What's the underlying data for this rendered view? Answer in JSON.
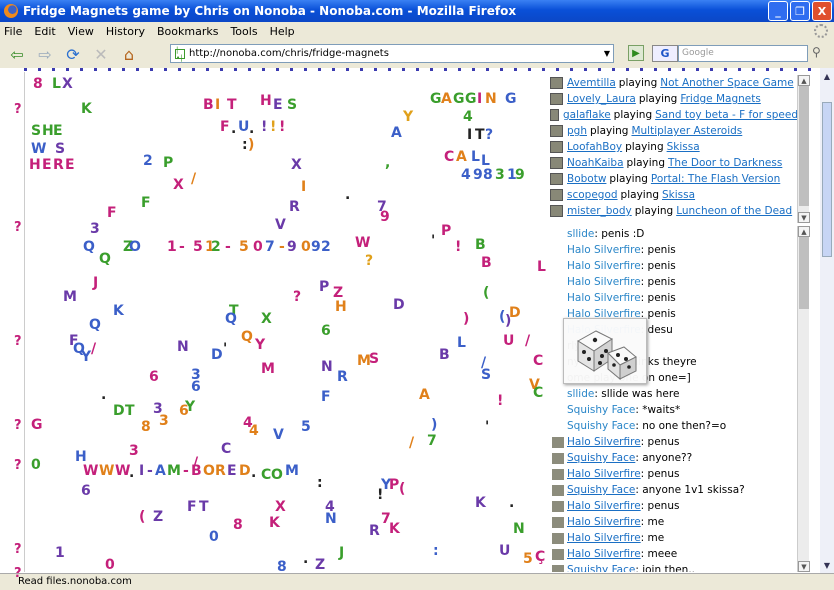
{
  "window": {
    "title": "Fridge Magnets game by Chris on Nonoba - Nonoba.com - Mozilla Firefox",
    "min_label": "_",
    "max_label": "❐",
    "close_label": "X"
  },
  "menu": [
    "File",
    "Edit",
    "View",
    "History",
    "Bookmarks",
    "Tools",
    "Help"
  ],
  "nav": {
    "back": "⇦",
    "forward": "⇨",
    "reload": "⟳",
    "stop": "✕",
    "home": "⌂",
    "url": "http://nonoba.com/chris/fridge-magnets",
    "go": "▶",
    "search_engine": "G",
    "search_placeholder": "Google",
    "search_icon": "⚲"
  },
  "colors": {
    "accent": "#0a50d8",
    "link": "#1a6fc4",
    "chat_name": "#2a86c8"
  },
  "magnets": [
    [
      "8",
      8,
      5,
      "#c4207a"
    ],
    [
      "L",
      27,
      5,
      "#3a9e2c"
    ],
    [
      "X",
      37,
      5,
      "#6a3aa8"
    ],
    [
      "K",
      56,
      30,
      "#3a9e2c"
    ],
    [
      "B",
      178,
      26,
      "#c4207a"
    ],
    [
      "I",
      190,
      26,
      "#e0801a"
    ],
    [
      "T",
      202,
      26,
      "#c4207a"
    ],
    [
      "H",
      235,
      22,
      "#c4207a"
    ],
    [
      "E",
      248,
      26,
      "#6a3aa8"
    ],
    [
      "S",
      262,
      26,
      "#3a9e2c"
    ],
    [
      "F",
      195,
      48,
      "#c4207a"
    ],
    [
      ".",
      206,
      50,
      "#222"
    ],
    [
      "U",
      213,
      48,
      "#3b5fc8"
    ],
    [
      ".",
      224,
      50,
      "#222"
    ],
    [
      "!",
      236,
      48,
      "#6a3aa8"
    ],
    [
      "!",
      245,
      48,
      "#e0a01a"
    ],
    [
      "!",
      254,
      48,
      "#c4207a"
    ],
    [
      ":",
      217,
      66,
      "#222"
    ],
    [
      ")",
      223,
      66,
      "#e0801a"
    ],
    [
      "G",
      405,
      20,
      "#3a9e2c"
    ],
    [
      "A",
      416,
      20,
      "#e0801a"
    ],
    [
      "G",
      428,
      20,
      "#3a9e2c"
    ],
    [
      "G",
      440,
      20,
      "#3a9e2c"
    ],
    [
      "I",
      452,
      20,
      "#c4207a"
    ],
    [
      "N",
      460,
      20,
      "#e0801a"
    ],
    [
      "G",
      480,
      20,
      "#3b5fc8"
    ],
    [
      "Y",
      378,
      38,
      "#e0a01a"
    ],
    [
      "4",
      438,
      38,
      "#3a9e2c"
    ],
    [
      "A",
      366,
      54,
      "#3b5fc8"
    ],
    [
      "I",
      442,
      56,
      "#222"
    ],
    [
      "T",
      450,
      56,
      "#222"
    ],
    [
      "?",
      460,
      56,
      "#3b5fc8"
    ],
    [
      "C",
      419,
      78,
      "#c4207a"
    ],
    [
      "A",
      431,
      78,
      "#e0801a"
    ],
    [
      "L",
      446,
      78,
      "#3b5fc8"
    ],
    [
      "L",
      456,
      82,
      "#3b5fc8"
    ],
    [
      "4",
      436,
      96,
      "#3b5fc8"
    ],
    [
      "9",
      448,
      96,
      "#3b5fc8"
    ],
    [
      "8",
      458,
      96,
      "#3b5fc8"
    ],
    [
      "3",
      470,
      96,
      "#3a9e2c"
    ],
    [
      "1",
      482,
      96,
      "#3b5fc8"
    ],
    [
      "9",
      490,
      96,
      "#3a9e2c"
    ],
    [
      "S",
      6,
      52,
      "#3a9e2c"
    ],
    [
      "H",
      17,
      52,
      "#3a9e2c"
    ],
    [
      "E",
      28,
      52,
      "#3a9e2c"
    ],
    [
      "W",
      6,
      70,
      "#3b5fc8"
    ],
    [
      "S",
      30,
      70,
      "#6a3aa8"
    ],
    [
      "H",
      4,
      86,
      "#c4207a"
    ],
    [
      "E",
      17,
      86,
      "#c4207a"
    ],
    [
      "R",
      28,
      86,
      "#c4207a"
    ],
    [
      "E",
      40,
      86,
      "#c4207a"
    ],
    [
      "2",
      118,
      82,
      "#3b5fc8"
    ],
    [
      "P",
      138,
      84,
      "#3a9e2c"
    ],
    [
      "X",
      148,
      106,
      "#c4207a"
    ],
    [
      "/",
      166,
      100,
      "#e0801a"
    ],
    [
      "X",
      266,
      86,
      "#6a3aa8"
    ],
    [
      "I",
      276,
      108,
      "#e0801a"
    ],
    [
      ",",
      360,
      84,
      "#3a9e2c"
    ],
    [
      "F",
      82,
      134,
      "#c4207a"
    ],
    [
      "F",
      116,
      124,
      "#3a9e2c"
    ],
    [
      "3",
      65,
      150,
      "#6a3aa8"
    ],
    [
      "R",
      264,
      128,
      "#6a3aa8"
    ],
    [
      "V",
      250,
      146,
      "#6a3aa8"
    ],
    [
      ".",
      320,
      116,
      "#222"
    ],
    [
      "7",
      352,
      128,
      "#6a3aa8"
    ],
    [
      "9",
      355,
      138,
      "#c4207a"
    ],
    [
      "P",
      416,
      152,
      "#c4207a"
    ],
    [
      "'",
      406,
      162,
      "#222"
    ],
    [
      "!",
      430,
      168,
      "#c4207a"
    ],
    [
      "B",
      450,
      166,
      "#3a9e2c"
    ],
    [
      "Q",
      58,
      168,
      "#3b5fc8"
    ],
    [
      "Z",
      98,
      168,
      "#3a9e2c"
    ],
    [
      "Q",
      74,
      180,
      "#3a9e2c"
    ],
    [
      "O",
      104,
      168,
      "#3b5fc8"
    ],
    [
      "1",
      142,
      168,
      "#c4207a"
    ],
    [
      "-",
      154,
      168,
      "#c4207a"
    ],
    [
      "5",
      168,
      168,
      "#c4207a"
    ],
    [
      "1",
      180,
      168,
      "#e0801a"
    ],
    [
      "2",
      186,
      168,
      "#3a9e2c"
    ],
    [
      "-",
      200,
      168,
      "#c4207a"
    ],
    [
      "5",
      214,
      168,
      "#e0801a"
    ],
    [
      "0",
      228,
      168,
      "#c4207a"
    ],
    [
      "7",
      240,
      168,
      "#3b5fc8"
    ],
    [
      "-",
      254,
      168,
      "#e0801a"
    ],
    [
      "9",
      262,
      168,
      "#6a3aa8"
    ],
    [
      "0",
      276,
      168,
      "#e0801a"
    ],
    [
      "9",
      286,
      168,
      "#3b5fc8"
    ],
    [
      "2",
      296,
      168,
      "#3b5fc8"
    ],
    [
      "W",
      330,
      164,
      "#c4207a"
    ],
    [
      "?",
      340,
      182,
      "#e0a01a"
    ],
    [
      "B",
      456,
      184,
      "#c4207a"
    ],
    [
      "L",
      512,
      188,
      "#c4207a"
    ],
    [
      "J",
      68,
      204,
      "#c4207a"
    ],
    [
      "M",
      38,
      218,
      "#6a3aa8"
    ],
    [
      "?",
      268,
      218,
      "#c4207a"
    ],
    [
      "P",
      294,
      208,
      "#6a3aa8"
    ],
    [
      "Z",
      308,
      214,
      "#c4207a"
    ],
    [
      "H",
      310,
      228,
      "#e0801a"
    ],
    [
      "D",
      368,
      226,
      "#6a3aa8"
    ],
    [
      "(",
      458,
      214,
      "#3a9e2c"
    ],
    [
      "K",
      88,
      232,
      "#3b5fc8"
    ],
    [
      "Q",
      64,
      246,
      "#3b5fc8"
    ],
    [
      "T",
      204,
      232,
      "#3a9e2c"
    ],
    [
      "Q",
      200,
      240,
      "#3b5fc8"
    ],
    [
      "X",
      236,
      240,
      "#3a9e2c"
    ],
    [
      "6",
      296,
      252,
      "#3a9e2c"
    ],
    [
      ")",
      438,
      240,
      "#c4207a"
    ],
    [
      "(",
      474,
      238,
      "#3b5fc8"
    ],
    [
      "D",
      484,
      234,
      "#e0801a"
    ],
    [
      ")",
      480,
      242,
      "#6a3aa8"
    ],
    [
      "Q",
      216,
      258,
      "#e0801a"
    ],
    [
      "Y",
      230,
      266,
      "#c4207a"
    ],
    [
      "F",
      44,
      262,
      "#6a3aa8"
    ],
    [
      "Q",
      48,
      270,
      "#3b5fc8"
    ],
    [
      "Y",
      56,
      278,
      "#3b5fc8"
    ],
    [
      "/",
      66,
      270,
      "#c4207a"
    ],
    [
      "N",
      152,
      268,
      "#6a3aa8"
    ],
    [
      "D",
      186,
      276,
      "#3b5fc8"
    ],
    [
      "'",
      198,
      270,
      "#222"
    ],
    [
      "L",
      432,
      264,
      "#3b5fc8"
    ],
    [
      "B",
      414,
      276,
      "#6a3aa8"
    ],
    [
      "U",
      478,
      262,
      "#c4207a"
    ],
    [
      "/",
      500,
      262,
      "#c4207a"
    ],
    [
      "C",
      508,
      282,
      "#c4207a"
    ],
    [
      "/",
      456,
      284,
      "#3b5fc8"
    ],
    [
      "M",
      236,
      290,
      "#c4207a"
    ],
    [
      "N",
      296,
      288,
      "#6a3aa8"
    ],
    [
      "R",
      312,
      298,
      "#3b5fc8"
    ],
    [
      "M",
      332,
      282,
      "#e0801a"
    ],
    [
      "S",
      344,
      280,
      "#c4207a"
    ],
    [
      "S",
      456,
      296,
      "#3b5fc8"
    ],
    [
      "6",
      124,
      298,
      "#c4207a"
    ],
    [
      "3",
      166,
      296,
      "#3b5fc8"
    ],
    [
      "6",
      166,
      308,
      "#3b5fc8"
    ],
    [
      ".",
      76,
      316,
      "#222"
    ],
    [
      "F",
      296,
      318,
      "#3b5fc8"
    ],
    [
      "A",
      394,
      316,
      "#e0801a"
    ],
    [
      "V",
      504,
      306,
      "#e0801a"
    ],
    [
      "C",
      508,
      314,
      "#3a9e2c"
    ],
    [
      "!",
      472,
      322,
      "#c4207a"
    ],
    [
      "D",
      88,
      332,
      "#3a9e2c"
    ],
    [
      "T",
      100,
      332,
      "#3a9e2c"
    ],
    [
      "3",
      128,
      330,
      "#6a3aa8"
    ],
    [
      "6",
      154,
      332,
      "#e0801a"
    ],
    [
      "Y",
      160,
      328,
      "#3a9e2c"
    ],
    [
      "8",
      116,
      348,
      "#e0801a"
    ],
    [
      "3",
      134,
      342,
      "#e0801a"
    ],
    [
      "4",
      218,
      344,
      "#c4207a"
    ],
    [
      "4",
      224,
      352,
      "#e0801a"
    ],
    [
      "V",
      248,
      356,
      "#3b5fc8"
    ],
    [
      "5",
      276,
      348,
      "#3b5fc8"
    ],
    [
      ")",
      406,
      346,
      "#3b5fc8"
    ],
    [
      "'",
      460,
      348,
      "#222"
    ],
    [
      "G",
      6,
      346,
      "#c4207a"
    ],
    [
      "C",
      196,
      370,
      "#6a3aa8"
    ],
    [
      "/",
      384,
      364,
      "#e0801a"
    ],
    [
      "7",
      402,
      362,
      "#3a9e2c"
    ],
    [
      "H",
      50,
      378,
      "#3b5fc8"
    ],
    [
      "3",
      104,
      372,
      "#c4207a"
    ],
    [
      "/",
      168,
      384,
      "#c4207a"
    ],
    [
      "0",
      6,
      386,
      "#3a9e2c"
    ],
    [
      "W",
      58,
      392,
      "#c4207a"
    ],
    [
      "W",
      74,
      392,
      "#e0801a"
    ],
    [
      "W",
      90,
      392,
      "#c4207a"
    ],
    [
      ".",
      104,
      394,
      "#222"
    ],
    [
      "I",
      114,
      392,
      "#6a3aa8"
    ],
    [
      "-",
      122,
      392,
      "#6a3aa8"
    ],
    [
      "A",
      130,
      392,
      "#3b5fc8"
    ],
    [
      "M",
      142,
      392,
      "#3a9e2c"
    ],
    [
      "-",
      158,
      392,
      "#c4207a"
    ],
    [
      "B",
      166,
      392,
      "#c4207a"
    ],
    [
      "O",
      178,
      392,
      "#e0801a"
    ],
    [
      "R",
      190,
      392,
      "#e0801a"
    ],
    [
      "E",
      202,
      392,
      "#6a3aa8"
    ],
    [
      "D",
      214,
      392,
      "#e0801a"
    ],
    [
      ".",
      226,
      394,
      "#222"
    ],
    [
      "C",
      236,
      396,
      "#3a9e2c"
    ],
    [
      "O",
      246,
      396,
      "#3a9e2c"
    ],
    [
      "M",
      260,
      392,
      "#3b5fc8"
    ],
    [
      "6",
      56,
      412,
      "#6a3aa8"
    ],
    [
      ":",
      292,
      404,
      "#222"
    ],
    [
      "Y",
      356,
      406,
      "#3b5fc8"
    ],
    [
      "P",
      364,
      406,
      "#c4207a"
    ],
    [
      "(",
      374,
      410,
      "#c4207a"
    ],
    [
      "!",
      352,
      416,
      "#222"
    ],
    [
      "K",
      450,
      424,
      "#6a3aa8"
    ],
    [
      ".",
      484,
      424,
      "#222"
    ],
    [
      "(",
      114,
      438,
      "#c4207a"
    ],
    [
      "Z",
      128,
      438,
      "#6a3aa8"
    ],
    [
      "F",
      162,
      428,
      "#6a3aa8"
    ],
    [
      "T",
      174,
      428,
      "#6a3aa8"
    ],
    [
      "X",
      250,
      428,
      "#c4207a"
    ],
    [
      "K",
      244,
      444,
      "#c4207a"
    ],
    [
      "4",
      300,
      428,
      "#6a3aa8"
    ],
    [
      "N",
      300,
      440,
      "#3b5fc8"
    ],
    [
      "7",
      356,
      440,
      "#c4207a"
    ],
    [
      "K",
      364,
      450,
      "#c4207a"
    ],
    [
      "R",
      344,
      452,
      "#6a3aa8"
    ],
    [
      "N",
      488,
      450,
      "#3a9e2c"
    ],
    [
      "8",
      208,
      446,
      "#c4207a"
    ],
    [
      "0",
      184,
      458,
      "#3b5fc8"
    ],
    [
      "1",
      30,
      474,
      "#6a3aa8"
    ],
    [
      ".",
      278,
      480,
      "#222"
    ],
    [
      "J",
      314,
      474,
      "#3a9e2c"
    ],
    [
      ":",
      408,
      472,
      "#3b5fc8"
    ],
    [
      "U",
      474,
      472,
      "#6a3aa8"
    ],
    [
      "0",
      80,
      486,
      "#c4207a"
    ],
    [
      "8",
      252,
      488,
      "#3b5fc8"
    ],
    [
      "Z",
      290,
      486,
      "#6a3aa8"
    ],
    [
      "5",
      498,
      480,
      "#e0801a"
    ],
    [
      "Ç",
      510,
      478,
      "#c4207a"
    ]
  ],
  "left_q": [
    "?",
    "?",
    "?",
    "?",
    "?",
    "?",
    "?"
  ],
  "players": [
    {
      "name": "Avemtilla",
      "game": "Not Another Space Game"
    },
    {
      "name": "Lovely_Laura",
      "game": "Fridge Magnets"
    },
    {
      "name": "galaflake",
      "game": "Sand toy beta - F for speed"
    },
    {
      "name": "pgh",
      "game": "Multiplayer Asteroids"
    },
    {
      "name": "LoofahBoy",
      "game": "Skissa"
    },
    {
      "name": "NoahKaiba",
      "game": "The Door to Darkness"
    },
    {
      "name": "Bobotw",
      "game": "Portal: The Flash Version"
    },
    {
      "name": "scopegod",
      "game": "Skissa"
    },
    {
      "name": "mister_body",
      "game": "Luncheon of the Dead"
    }
  ],
  "playing_word": "playing",
  "chat": [
    {
      "name": "sllide",
      "msg": ": penis :D",
      "icon": false,
      "u": false
    },
    {
      "name": "Halo Silverfire",
      "msg": ": penis",
      "icon": false,
      "u": false
    },
    {
      "name": "Halo Silverfire",
      "msg": ": penis",
      "icon": false,
      "u": false
    },
    {
      "name": "Halo Silverfire",
      "msg": ": penis",
      "icon": false,
      "u": false
    },
    {
      "name": "Halo Silverfire",
      "msg": ": penis",
      "icon": false,
      "u": false
    },
    {
      "name": "Halo Silverfire",
      "msg": ": penis",
      "icon": false,
      "u": false
    },
    {
      "name": "Halo Silverfire",
      "msg": ": desu",
      "icon": false,
      "u": false
    },
    {
      "name": "",
      "msg": "rly",
      "icon": false,
      "u": false
    },
    {
      "name": "",
      "msg": "nyone that thinks theyre",
      "icon": false,
      "u": false
    },
    {
      "name": "",
      "msg": "ome play one on one=]",
      "icon": false,
      "u": false
    },
    {
      "name": "sllide",
      "msg": ": sllide was here",
      "icon": false,
      "u": false
    },
    {
      "name": "Squishy Face",
      "msg": ": *waits*",
      "icon": false,
      "u": false
    },
    {
      "name": "Squishy Face",
      "msg": ": no one then?=o",
      "icon": false,
      "u": false
    },
    {
      "name": "Halo Silverfire",
      "msg": ": penus",
      "icon": true,
      "u": true
    },
    {
      "name": "Squishy Face",
      "msg": ": anyone??",
      "icon": true,
      "u": true
    },
    {
      "name": "Halo Silverfire",
      "msg": ": penus",
      "icon": true,
      "u": true
    },
    {
      "name": "Squishy Face",
      "msg": ": anyone 1v1 skissa?",
      "icon": true,
      "u": true
    },
    {
      "name": "Halo Silverfire",
      "msg": ": penus",
      "icon": true,
      "u": true
    },
    {
      "name": "Halo Silverfire",
      "msg": ": me",
      "icon": true,
      "u": true
    },
    {
      "name": "Halo Silverfire",
      "msg": ": me",
      "icon": true,
      "u": true
    },
    {
      "name": "Halo Silverfire",
      "msg": ": meee",
      "icon": true,
      "u": true
    },
    {
      "name": "Squishy Face",
      "msg": ": join then..",
      "icon": true,
      "u": true
    }
  ],
  "status": "Read files.nonoba.com"
}
